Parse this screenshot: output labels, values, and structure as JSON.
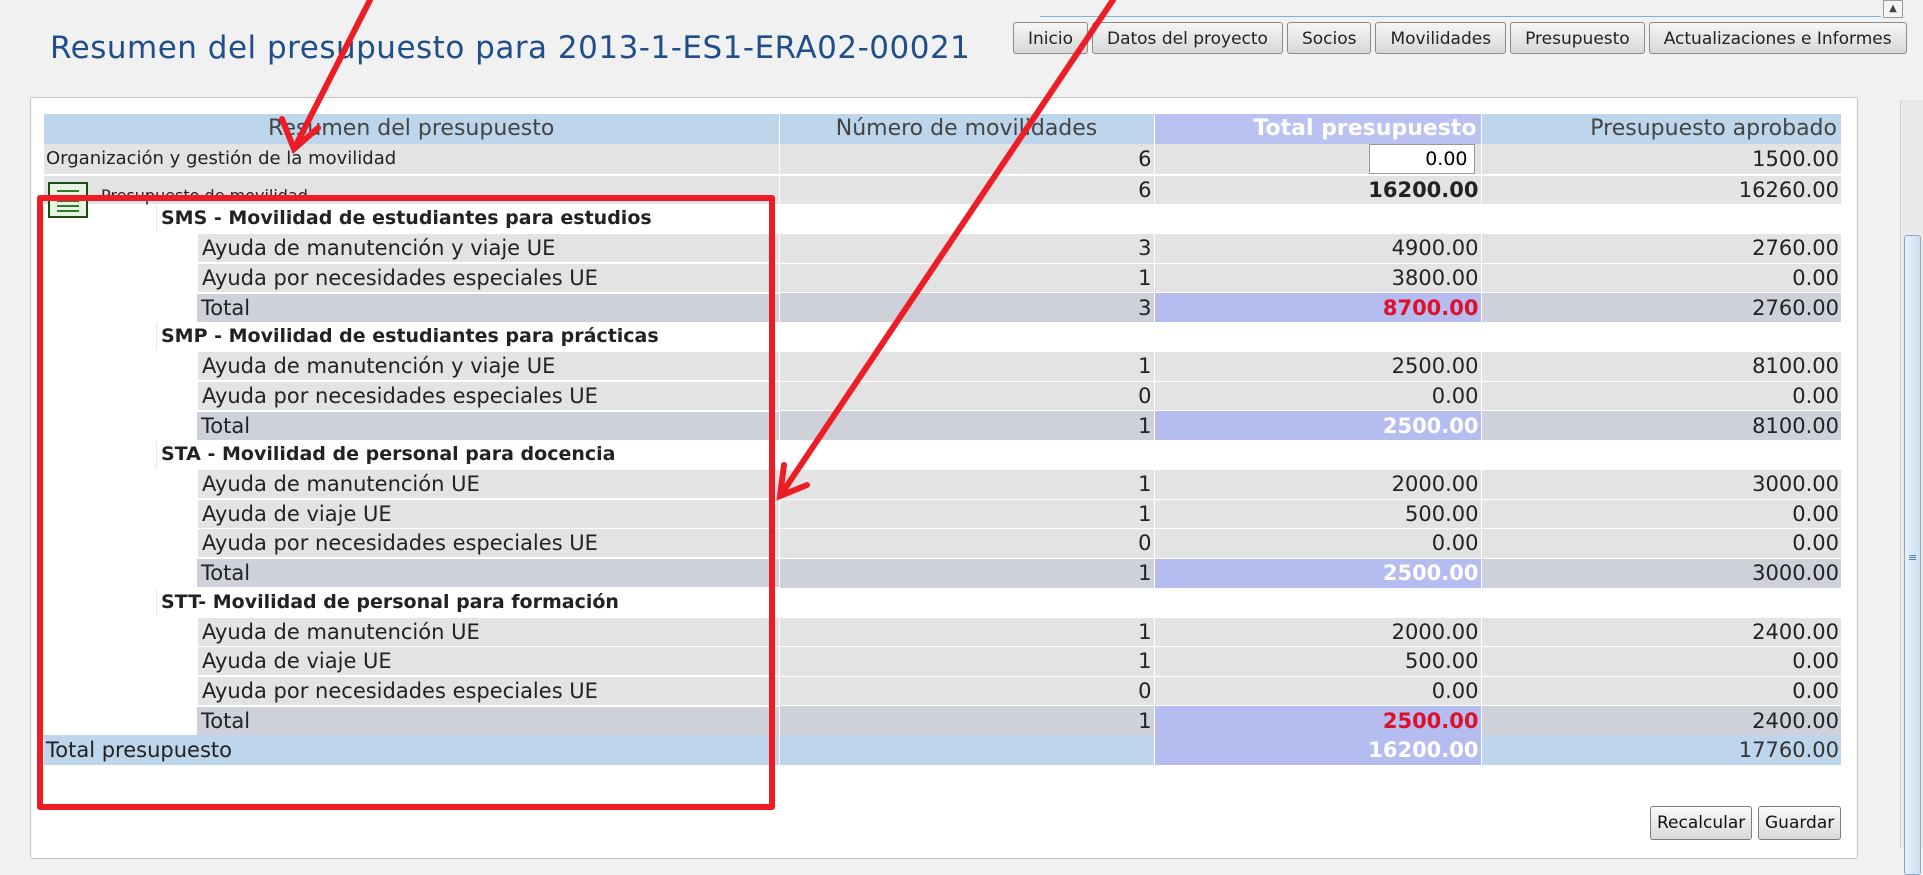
{
  "title": "Resumen del presupuesto para 2013-1-ES1-ERA02-00021",
  "tabs": [
    "Inicio",
    "Datos del proyecto",
    "Socios",
    "Movilidades",
    "Presupuesto",
    "Actualizaciones e Informes"
  ],
  "table": {
    "headers": {
      "summary": "Resumen del presupuesto",
      "mobilities": "Número de movilidades",
      "total_budget": "Total presupuesto",
      "approved_budget": "Presupuesto aprobado"
    },
    "organization": {
      "label": "Organización y gestión de la movilidad",
      "mobilities": "6",
      "total_input": "0.00",
      "approved": "1500.00"
    },
    "mobility_budget": {
      "label": "Presupuesto de movilidad",
      "mobilities": "6",
      "total": "16200.00",
      "approved": "16260.00"
    },
    "sections": [
      {
        "title": "SMS - Movilidad de estudiantes para estudios",
        "items": [
          {
            "label": "Ayuda de manutención y viaje UE",
            "mobilities": "3",
            "total": "4900.00",
            "approved": "2760.00"
          },
          {
            "label": "Ayuda por necesidades especiales UE",
            "mobilities": "1",
            "total": "3800.00",
            "approved": "0.00"
          }
        ],
        "total": {
          "label": "Total",
          "mobilities": "3",
          "total": "8700.00",
          "approved": "2760.00",
          "color": "#e0102b"
        }
      },
      {
        "title": "SMP - Movilidad de estudiantes para prácticas",
        "items": [
          {
            "label": "Ayuda de manutención y viaje UE",
            "mobilities": "1",
            "total": "2500.00",
            "approved": "8100.00"
          },
          {
            "label": "Ayuda por necesidades especiales UE",
            "mobilities": "0",
            "total": "0.00",
            "approved": "0.00"
          }
        ],
        "total": {
          "label": "Total",
          "mobilities": "1",
          "total": "2500.00",
          "approved": "8100.00",
          "color": "#ffffff"
        }
      },
      {
        "title": "STA - Movilidad de personal para docencia",
        "items": [
          {
            "label": "Ayuda de manutención UE",
            "mobilities": "1",
            "total": "2000.00",
            "approved": "3000.00"
          },
          {
            "label": "Ayuda de viaje UE",
            "mobilities": "1",
            "total": "500.00",
            "approved": "0.00"
          },
          {
            "label": "Ayuda por necesidades especiales UE",
            "mobilities": "0",
            "total": "0.00",
            "approved": "0.00"
          }
        ],
        "total": {
          "label": "Total",
          "mobilities": "1",
          "total": "2500.00",
          "approved": "3000.00",
          "color": "#ffffff"
        }
      },
      {
        "title": "STT- Movilidad de personal para formación",
        "items": [
          {
            "label": "Ayuda de manutención UE",
            "mobilities": "1",
            "total": "2000.00",
            "approved": "2400.00"
          },
          {
            "label": "Ayuda de viaje UE",
            "mobilities": "1",
            "total": "500.00",
            "approved": "0.00"
          },
          {
            "label": "Ayuda por necesidades especiales UE",
            "mobilities": "0",
            "total": "0.00",
            "approved": "0.00"
          }
        ],
        "total": {
          "label": "Total",
          "mobilities": "1",
          "total": "2500.00",
          "approved": "2400.00",
          "color": "#e0102b"
        }
      }
    ],
    "grand_total": {
      "label": "Total presupuesto",
      "total": "16200.00",
      "approved": "17760.00"
    }
  },
  "buttons": {
    "recalculate": "Recalcular",
    "save": "Guardar"
  },
  "colors": {
    "header": "#bdd6ec",
    "total_column": "#b9c2f0",
    "annotation": "#ee1c24",
    "title": "#1f4e8a"
  }
}
